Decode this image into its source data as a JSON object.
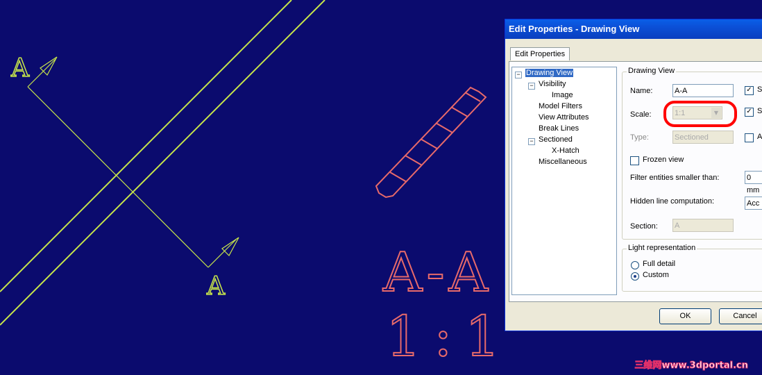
{
  "drawing": {
    "section_label_top": "A",
    "section_label_bottom": "A",
    "view_name": "A-A",
    "view_scale": "1:1"
  },
  "dialog": {
    "title": "Edit Properties - Drawing View",
    "tab": "Edit Properties",
    "tree": [
      "Drawing View",
      "Visibility",
      "Image",
      "Model Filters",
      "View Attributes",
      "Break Lines",
      "Sectioned",
      "X-Hatch",
      "Miscellaneous"
    ],
    "group_drawing_view": "Drawing View",
    "name_label": "Name:",
    "name_value": "A-A",
    "scale_label": "Scale:",
    "scale_value": "1:1",
    "type_label": "Type:",
    "type_value": "Sectioned",
    "frozen_label": "Frozen view",
    "filter_label": "Filter entities smaller than:",
    "filter_value": "0 mm",
    "hidden_label": "Hidden line computation:",
    "hidden_value": "Acc",
    "section_label": "Section:",
    "section_value": "A",
    "group_light": "Light representation",
    "full_detail": "Full detail",
    "custom": "Custom",
    "right_checks": [
      "S",
      "S",
      "A"
    ],
    "ok": "OK",
    "cancel": "Cancel",
    "highlight_color": "#ff0000"
  },
  "watermark": "三维网www.3dportal.cn"
}
